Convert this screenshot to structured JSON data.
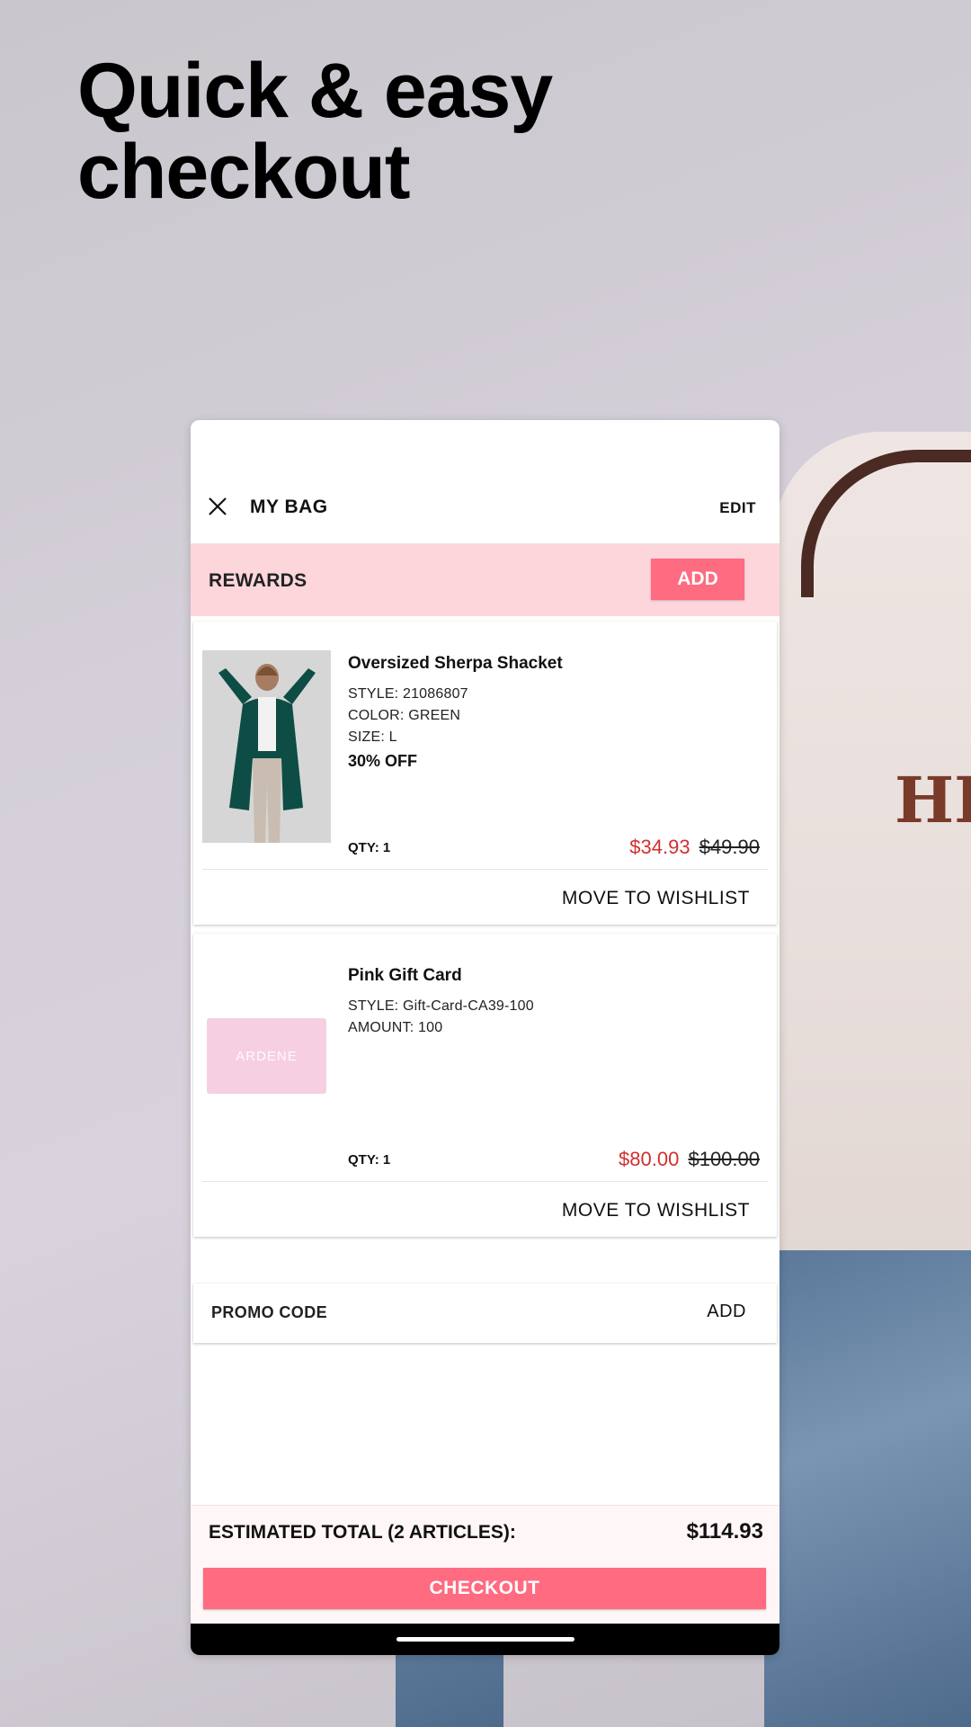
{
  "headline": [
    "Quick & easy",
    "checkout"
  ],
  "header": {
    "title": "MY BAG",
    "edit_label": "EDIT"
  },
  "rewards": {
    "label": "REWARDS",
    "add_label": "ADD"
  },
  "items": [
    {
      "name": "Oversized Sherpa Shacket",
      "style": "STYLE: 21086807",
      "color": "COLOR: GREEN",
      "size": "SIZE: L",
      "discount": "30% OFF",
      "qty": "QTY: 1",
      "sale_price": "$34.93",
      "original_price": "$49.90",
      "move_label": "MOVE TO WISHLIST"
    },
    {
      "name": "Pink Gift Card",
      "style": "STYLE: Gift-Card-CA39-100",
      "amount": "AMOUNT: 100",
      "card_brand": "ARDENE",
      "qty": "QTY: 1",
      "sale_price": "$80.00",
      "original_price": "$100.00",
      "move_label": "MOVE TO WISHLIST"
    }
  ],
  "promo": {
    "label": "PROMO CODE",
    "add_label": "ADD"
  },
  "summary": {
    "total_label": "ESTIMATED TOTAL (2 ARTICLES):",
    "total_value": "$114.93",
    "checkout_label": "CHECKOUT"
  },
  "colors": {
    "accent": "#ff6b80",
    "rewards_bg": "#fdd6dc",
    "sale_red": "#d32f2f"
  },
  "background_print": "HE"
}
